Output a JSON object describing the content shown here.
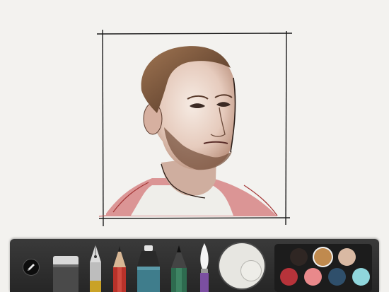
{
  "app": {
    "toolbar": {
      "more_icon": "pencil-icon",
      "tools": [
        {
          "name": "eraser",
          "icon": "eraser-icon"
        },
        {
          "name": "fountain-pen",
          "icon": "fountain-pen-icon",
          "color": "#c9a227"
        },
        {
          "name": "pencil",
          "icon": "pencil-icon",
          "color": "#b8322a"
        },
        {
          "name": "marker",
          "icon": "marker-icon",
          "color": "#3f7d8c"
        },
        {
          "name": "brush",
          "icon": "brush-icon",
          "color": "#2e6b4f"
        },
        {
          "name": "watercolor",
          "icon": "watercolor-brush-icon",
          "color": "#7b4fa1"
        }
      ],
      "mixer_icon": "color-mixer-icon",
      "palette": [
        {
          "color": "#2f2623",
          "selected": false
        },
        {
          "color": "#c08a4e",
          "selected": true
        },
        {
          "color": "#d9b9a3",
          "selected": false
        },
        {
          "color": "#b7333a",
          "selected": false
        },
        {
          "color": "#e9898b",
          "selected": false
        },
        {
          "color": "#2f4f6b",
          "selected": false
        },
        {
          "color": "#8fd6dc",
          "selected": false
        }
      ]
    }
  }
}
